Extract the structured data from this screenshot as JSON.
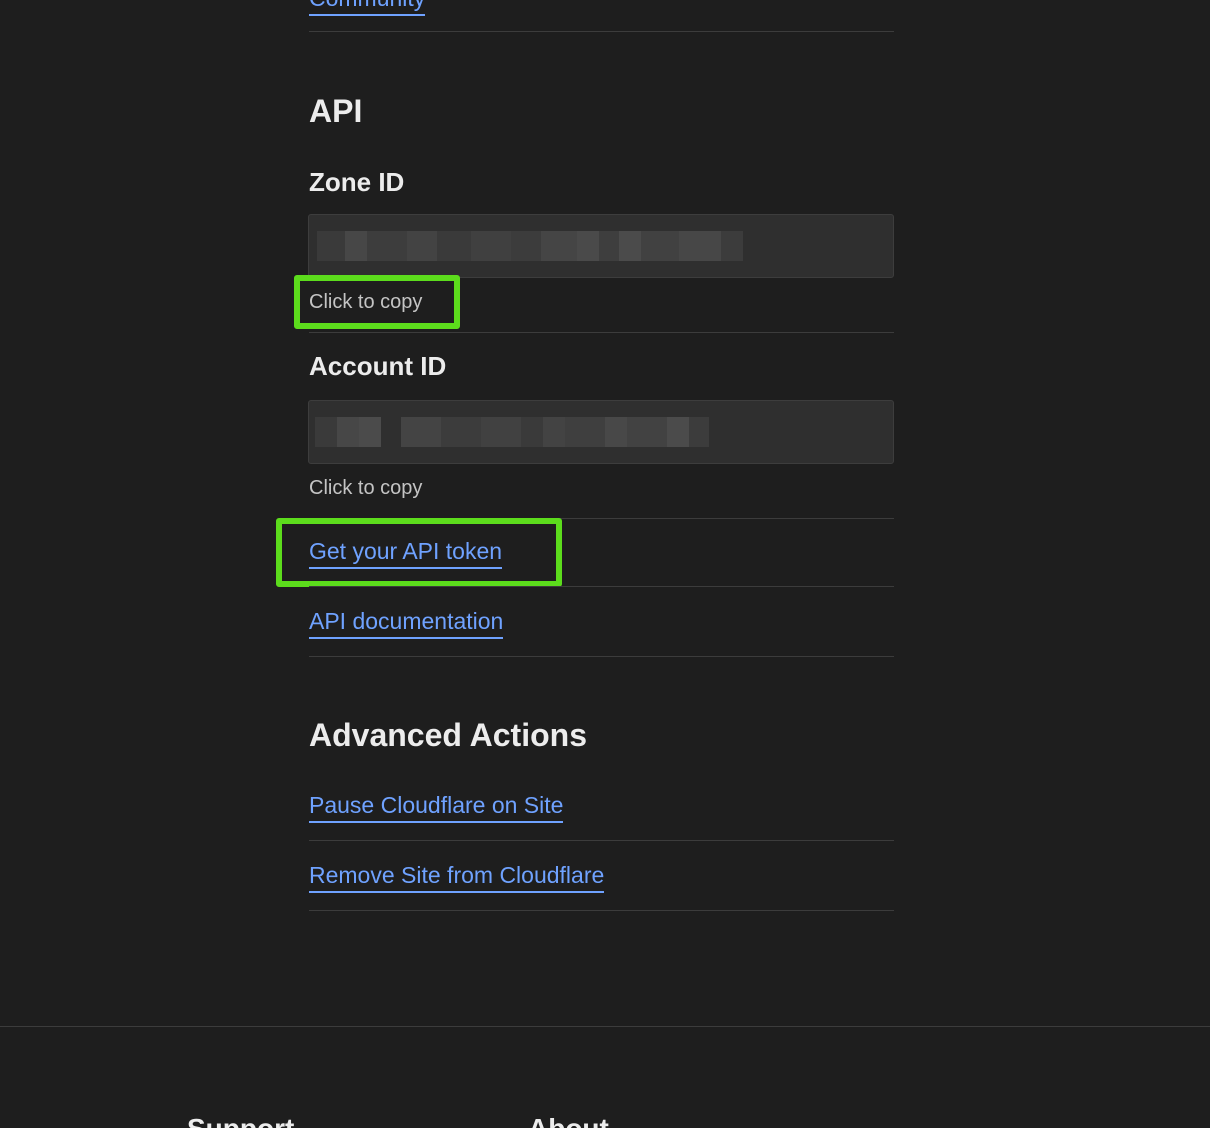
{
  "top": {
    "community_link": "Community"
  },
  "api": {
    "title": "API",
    "zone_id": {
      "label": "Zone ID",
      "hint": "Click to copy"
    },
    "account_id": {
      "label": "Account ID",
      "hint": "Click to copy"
    },
    "token_link": "Get your API token",
    "docs_link": "API documentation"
  },
  "advanced": {
    "title": "Advanced Actions",
    "pause_link": "Pause Cloudflare on Site",
    "remove_link": "Remove Site from Cloudflare"
  },
  "footer": {
    "col1_heading": "Support",
    "col2_heading": "About"
  },
  "colors": {
    "background": "#1e1e1e",
    "link": "#6fa2ff",
    "highlight": "#5cdc1c",
    "field_bg": "#2f2f2f"
  }
}
